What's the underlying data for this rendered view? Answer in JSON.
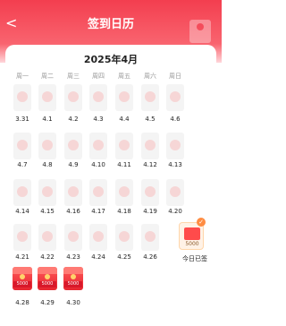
{
  "header": {
    "title": "签到日历",
    "back_icon": "chevron-left-icon"
  },
  "calendar": {
    "month_title": "2025年4月",
    "weekdays": [
      "周一",
      "周二",
      "周三",
      "周四",
      "周五",
      "周六",
      "周日"
    ],
    "rows": [
      [
        "3.31",
        "4.1",
        "4.2",
        "4.3",
        "4.4",
        "4.5",
        "4.6"
      ],
      [
        "4.7",
        "4.8",
        "4.9",
        "4.10",
        "4.11",
        "4.12",
        "4.13"
      ],
      [
        "4.14",
        "4.15",
        "4.16",
        "4.17",
        "4.18",
        "4.19",
        "4.20"
      ],
      [
        "4.21",
        "4.22",
        "4.23",
        "4.24",
        "4.25",
        "4.26",
        "今日已签"
      ],
      [
        "4.28",
        "4.29",
        "4.30"
      ]
    ],
    "today": {
      "amount": "5000",
      "icon": "red-envelope-icon",
      "checked_icon": "check-icon"
    },
    "reward_amount": "5000"
  },
  "colors": {
    "brand": "#f33e4f"
  }
}
